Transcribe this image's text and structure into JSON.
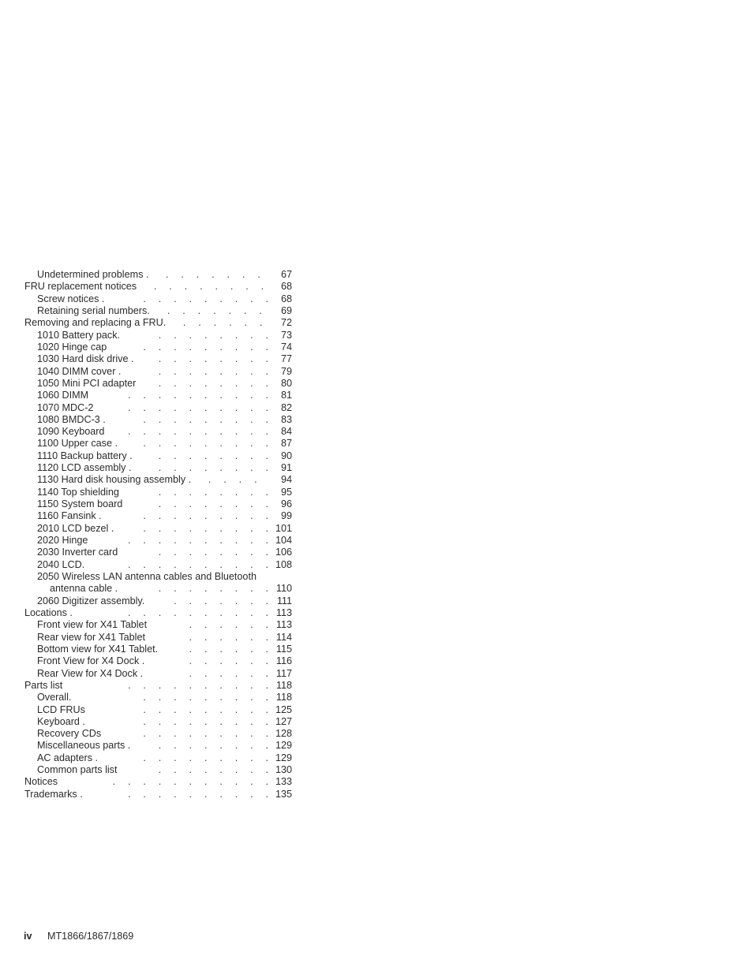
{
  "document": {
    "type": "table-of-contents"
  },
  "toc": {
    "entries": [
      {
        "title": "Undetermined problems .",
        "page": "67",
        "level": 1,
        "dots": 9
      },
      {
        "title": "FRU replacement notices",
        "page": "68",
        "level": 0,
        "dots": 9
      },
      {
        "title": "Screw notices .",
        "page": "68",
        "level": 1,
        "dots": 9
      },
      {
        "title": "Retaining serial numbers.",
        "page": "69",
        "level": 1,
        "dots": 8
      },
      {
        "title": "Removing and replacing a FRU.",
        "page": "72",
        "level": 0,
        "dots": 7
      },
      {
        "title": "1010 Battery pack.",
        "page": "73",
        "level": 1,
        "dots": 8
      },
      {
        "title": "1020 Hinge cap",
        "page": "74",
        "level": 1,
        "dots": 9
      },
      {
        "title": "1030 Hard disk drive .",
        "page": "77",
        "level": 1,
        "dots": 8
      },
      {
        "title": "1040 DIMM cover .",
        "page": "79",
        "level": 1,
        "dots": 8
      },
      {
        "title": "1050 Mini PCI adapter",
        "page": "80",
        "level": 1,
        "dots": 8
      },
      {
        "title": "1060 DIMM",
        "page": "81",
        "level": 1,
        "dots": 10
      },
      {
        "title": "1070 MDC-2",
        "page": "82",
        "level": 1,
        "dots": 10
      },
      {
        "title": "1080 BMDC-3 .",
        "page": "83",
        "level": 1,
        "dots": 9
      },
      {
        "title": "1090 Keyboard",
        "page": "84",
        "level": 1,
        "dots": 10
      },
      {
        "title": "1100 Upper case .",
        "page": "87",
        "level": 1,
        "dots": 9
      },
      {
        "title": "1110 Backup battery .",
        "page": "90",
        "level": 1,
        "dots": 8
      },
      {
        "title": "1120 LCD assembly .",
        "page": "91",
        "level": 1,
        "dots": 8
      },
      {
        "title": "1130 Hard disk housing assembly .",
        "page": "94",
        "level": 1,
        "dots": 5
      },
      {
        "title": "1140 Top shielding",
        "page": "95",
        "level": 1,
        "dots": 8
      },
      {
        "title": "1150 System board",
        "page": "96",
        "level": 1,
        "dots": 8
      },
      {
        "title": "1160 Fansink .",
        "page": "99",
        "level": 1,
        "dots": 9
      },
      {
        "title": "2010 LCD bezel .",
        "page": "101",
        "level": 1,
        "dots": 9
      },
      {
        "title": "2020 Hinge",
        "page": "104",
        "level": 1,
        "dots": 10
      },
      {
        "title": "2030 Inverter card",
        "page": "106",
        "level": 1,
        "dots": 8
      },
      {
        "title": "2040 LCD.",
        "page": "108",
        "level": 1,
        "dots": 10
      },
      {
        "title": "2050 Wireless LAN antenna cables and Bluetooth",
        "page": "",
        "level": 1,
        "dots": 0,
        "wrap": true
      },
      {
        "title": "antenna cable .",
        "page": "110",
        "level": 2,
        "dots": 8
      },
      {
        "title": "2060 Digitizer assembly.",
        "page": "111",
        "level": 1,
        "dots": 7
      },
      {
        "title": "Locations .",
        "page": "113",
        "level": 0,
        "dots": 10
      },
      {
        "title": "Front view for X41 Tablet",
        "page": "113",
        "level": 1,
        "dots": 6
      },
      {
        "title": "Rear view for X41 Tablet",
        "page": "114",
        "level": 1,
        "dots": 6
      },
      {
        "title": "Bottom view for X41 Tablet.",
        "page": "115",
        "level": 1,
        "dots": 6
      },
      {
        "title": "Front View for X4 Dock .",
        "page": "116",
        "level": 1,
        "dots": 6
      },
      {
        "title": "Rear View for X4 Dock .",
        "page": "117",
        "level": 1,
        "dots": 6
      },
      {
        "title": "Parts list",
        "page": "118",
        "level": 0,
        "dots": 10
      },
      {
        "title": "Overall.",
        "page": "118",
        "level": 1,
        "dots": 9
      },
      {
        "title": "LCD FRUs",
        "page": "125",
        "level": 1,
        "dots": 9
      },
      {
        "title": "Keyboard .",
        "page": "127",
        "level": 1,
        "dots": 9
      },
      {
        "title": "Recovery CDs",
        "page": "128",
        "level": 1,
        "dots": 9
      },
      {
        "title": "Miscellaneous parts .",
        "page": "129",
        "level": 1,
        "dots": 8
      },
      {
        "title": "AC adapters .",
        "page": "129",
        "level": 1,
        "dots": 9
      },
      {
        "title": "Common parts list",
        "page": "130",
        "level": 1,
        "dots": 8
      },
      {
        "title": "Notices",
        "page": "133",
        "level": 0,
        "dots": 11
      },
      {
        "title": "Trademarks .",
        "page": "135",
        "level": 0,
        "dots": 10
      }
    ]
  },
  "footer": {
    "folio": "iv",
    "document_id": "MT1866/1867/1869"
  }
}
